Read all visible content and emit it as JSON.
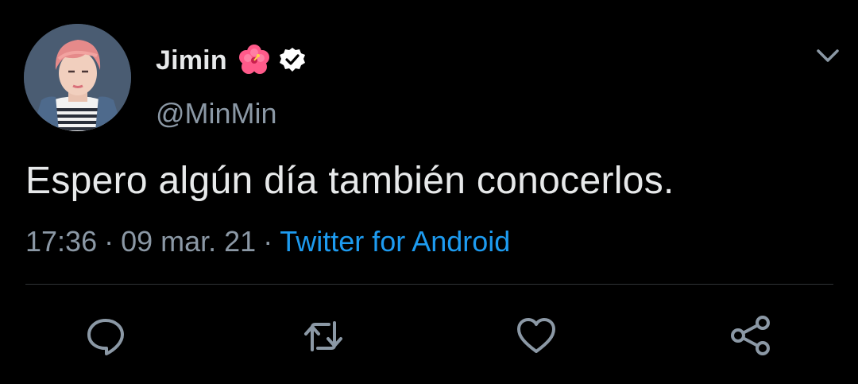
{
  "tweet": {
    "author": {
      "display_name": "Jimin",
      "name_emoji": "hibiscus-icon",
      "verified_badge": "verified-icon",
      "handle": "@MinMin"
    },
    "text": "Espero algún día también conocerlos.",
    "meta": {
      "time": "17:36",
      "separator": "·",
      "date": "09 mar. 21",
      "source": "Twitter for Android"
    },
    "menu_icon": "chevron-down-icon",
    "actions": [
      {
        "icon": "reply-icon"
      },
      {
        "icon": "retweet-icon"
      },
      {
        "icon": "like-icon"
      },
      {
        "icon": "share-icon"
      }
    ]
  },
  "colors": {
    "background": "#000000",
    "primary_text": "#e7e9ea",
    "secondary_text": "#8b98a5",
    "link": "#1d9bf0",
    "divider": "#2f3336",
    "flower": "#ff5a8a"
  }
}
